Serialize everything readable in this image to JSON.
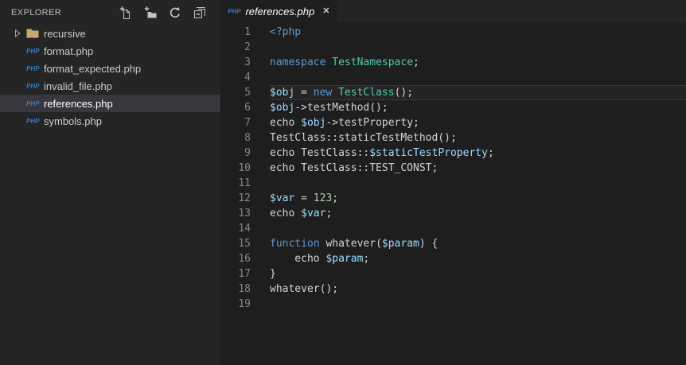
{
  "colors": {
    "editor_bg": "#1E1E1E",
    "sidebar_bg": "#252526",
    "tabbar_bg": "#252526",
    "selection_bg": "#37373D",
    "sidebar_fg": "#CCCCCC",
    "panel_title": "#BBBBBB",
    "tab_fg": "#FFFFFF",
    "keyword": "#569CD6",
    "class_name": "#4EC9B0",
    "variable": "#9CDCFE",
    "number": "#B5CEA8",
    "default_text": "#D4D4D4",
    "line_number": "#858585",
    "php_badge": "#2F7BC3",
    "icon_fg": "#C5C5C5",
    "folder_icon": "#C8A772"
  },
  "sidebar": {
    "title": "EXPLORER",
    "php_badge_label": "PHP",
    "actions": [
      {
        "name": "new-file"
      },
      {
        "name": "new-folder"
      },
      {
        "name": "refresh"
      },
      {
        "name": "collapse-all"
      }
    ],
    "files": [
      {
        "label": "recursive",
        "kind": "folder",
        "selected": false
      },
      {
        "label": "format.php",
        "kind": "php",
        "selected": false
      },
      {
        "label": "format_expected.php",
        "kind": "php",
        "selected": false
      },
      {
        "label": "invalid_file.php",
        "kind": "php",
        "selected": false
      },
      {
        "label": "references.php",
        "kind": "php",
        "selected": true
      },
      {
        "label": "symbols.php",
        "kind": "php",
        "selected": false
      }
    ]
  },
  "tab": {
    "label": "references.php",
    "icon_label": "PHP",
    "close_glyph": "✕"
  },
  "editor": {
    "language": "php",
    "lines": [
      {
        "n": 1,
        "current": false,
        "tokens": [
          [
            "kw",
            "<?php"
          ]
        ]
      },
      {
        "n": 2,
        "current": false,
        "tokens": []
      },
      {
        "n": 3,
        "current": false,
        "tokens": [
          [
            "kw",
            "namespace"
          ],
          [
            "pl",
            " "
          ],
          [
            "cl",
            "TestNamespace"
          ],
          [
            "pl",
            ";"
          ]
        ]
      },
      {
        "n": 4,
        "current": false,
        "tokens": []
      },
      {
        "n": 5,
        "current": true,
        "tokens": [
          [
            "var",
            "$obj"
          ],
          [
            "pl",
            " = "
          ],
          [
            "kw",
            "new"
          ],
          [
            "pl",
            " "
          ],
          [
            "cl",
            "TestClass"
          ],
          [
            "pl",
            "();"
          ]
        ]
      },
      {
        "n": 6,
        "current": false,
        "tokens": [
          [
            "var",
            "$obj"
          ],
          [
            "pl",
            "->testMethod();"
          ]
        ]
      },
      {
        "n": 7,
        "current": false,
        "tokens": [
          [
            "pl",
            "echo "
          ],
          [
            "var",
            "$obj"
          ],
          [
            "pl",
            "->testProperty;"
          ]
        ]
      },
      {
        "n": 8,
        "current": false,
        "tokens": [
          [
            "pl",
            "TestClass::staticTestMethod();"
          ]
        ]
      },
      {
        "n": 9,
        "current": false,
        "tokens": [
          [
            "pl",
            "echo TestClass::"
          ],
          [
            "var",
            "$staticTestProperty"
          ],
          [
            "pl",
            ";"
          ]
        ]
      },
      {
        "n": 10,
        "current": false,
        "tokens": [
          [
            "pl",
            "echo TestClass::TEST_CONST;"
          ]
        ]
      },
      {
        "n": 11,
        "current": false,
        "tokens": []
      },
      {
        "n": 12,
        "current": false,
        "tokens": [
          [
            "var",
            "$var"
          ],
          [
            "pl",
            " = "
          ],
          [
            "num",
            "123"
          ],
          [
            "pl",
            ";"
          ]
        ]
      },
      {
        "n": 13,
        "current": false,
        "tokens": [
          [
            "pl",
            "echo "
          ],
          [
            "var",
            "$var"
          ],
          [
            "pl",
            ";"
          ]
        ]
      },
      {
        "n": 14,
        "current": false,
        "tokens": []
      },
      {
        "n": 15,
        "current": false,
        "tokens": [
          [
            "kw",
            "function"
          ],
          [
            "pl",
            " whatever("
          ],
          [
            "var",
            "$param"
          ],
          [
            "pl",
            ") {"
          ]
        ]
      },
      {
        "n": 16,
        "current": false,
        "tokens": [
          [
            "pl",
            "    echo "
          ],
          [
            "var",
            "$param"
          ],
          [
            "pl",
            ";"
          ]
        ]
      },
      {
        "n": 17,
        "current": false,
        "tokens": [
          [
            "pl",
            "}"
          ]
        ]
      },
      {
        "n": 18,
        "current": false,
        "tokens": [
          [
            "pl",
            "whatever();"
          ]
        ]
      },
      {
        "n": 19,
        "current": false,
        "tokens": []
      }
    ]
  }
}
